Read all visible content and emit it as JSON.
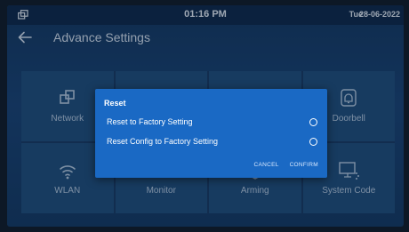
{
  "status_bar": {
    "time": "01:16 PM",
    "day": "Tue",
    "date": "28-06-2022"
  },
  "header": {
    "title": "Advance Settings"
  },
  "tiles": [
    {
      "label": "Network",
      "icon": "network-icon"
    },
    {
      "label": "",
      "icon": ""
    },
    {
      "label": "",
      "icon": ""
    },
    {
      "label": "Doorbell",
      "icon": "bell-icon"
    },
    {
      "label": "WLAN",
      "icon": "wifi-icon"
    },
    {
      "label": "Monitor",
      "icon": "camera-icon"
    },
    {
      "label": "Arming",
      "icon": "shield-icon"
    },
    {
      "label": "System Code",
      "icon": "screen-code-icon"
    }
  ],
  "dialog": {
    "title": "Reset",
    "options": [
      {
        "label": "Reset to Factory Setting",
        "selected": false
      },
      {
        "label": "Reset Config to Factory Setting",
        "selected": false
      }
    ],
    "cancel_label": "CANCEL",
    "confirm_label": "CONFIRM"
  }
}
